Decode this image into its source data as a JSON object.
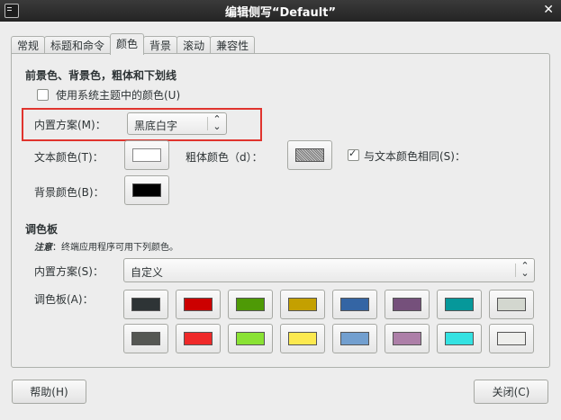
{
  "window": {
    "title": "编辑侧写“Default”"
  },
  "tabs": [
    {
      "label": "常规"
    },
    {
      "label": "标题和命令"
    },
    {
      "label": "颜色"
    },
    {
      "label": "背景"
    },
    {
      "label": "滚动"
    },
    {
      "label": "兼容性"
    }
  ],
  "fg_section": {
    "title": "前景色、背景色，粗体和下划线",
    "use_system_label": "使用系统主题中的颜色(U)",
    "use_system_checked": false,
    "scheme_label": "内置方案(M)：",
    "scheme_value": "黑底白字",
    "text_color_label": "文本颜色(T)：",
    "text_color": "#ffffff",
    "bold_color_label": "粗体颜色（d）：",
    "same_as_text_label": "与文本颜色相同(S)：",
    "same_as_text_checked": true,
    "bg_color_label": "背景颜色(B)：",
    "bg_color": "#000000"
  },
  "palette_section": {
    "title": "调色板",
    "note_prefix": "注意",
    "note_text": "：终端应用程序可用下列颜色。",
    "scheme_label": "内置方案(S)：",
    "scheme_value": "自定义",
    "palette_label": "调色板(A)：",
    "row1": [
      "#2e3436",
      "#cc0000",
      "#4e9a06",
      "#c4a000",
      "#3465a4",
      "#75507b",
      "#06989a",
      "#d3d7cf"
    ],
    "row2": [
      "#555753",
      "#ef2929",
      "#8ae234",
      "#fce94f",
      "#729fcf",
      "#ad7fa8",
      "#34e2e2",
      "#eeeeec"
    ]
  },
  "buttons": {
    "help": "帮助(H)",
    "close": "关闭(C)"
  }
}
